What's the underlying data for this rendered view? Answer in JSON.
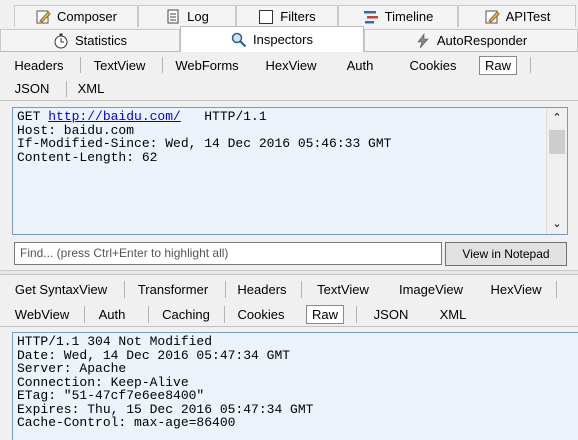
{
  "main_tabs_row1": [
    {
      "label": "Composer",
      "icon": "pencil-doc-icon"
    },
    {
      "label": "Log",
      "icon": "log-icon"
    },
    {
      "label": "Filters",
      "icon": "checkbox-icon"
    },
    {
      "label": "Timeline",
      "icon": "timeline-icon"
    },
    {
      "label": "APITest",
      "icon": "pencil-doc-icon"
    }
  ],
  "main_tabs_row2": [
    {
      "label": "Statistics",
      "icon": "stopwatch-icon"
    },
    {
      "label": "Inspectors",
      "icon": "magnifier-icon"
    },
    {
      "label": "AutoResponder",
      "icon": "lightning-icon"
    }
  ],
  "request": {
    "tabs_row1": [
      "Headers",
      "TextView",
      "WebForms",
      "HexView",
      "Auth",
      "Cookies",
      "Raw"
    ],
    "tabs_row2": [
      "JSON",
      "XML"
    ],
    "selected_tab": "Raw",
    "raw": {
      "method": "GET",
      "url": "http://baidu.com/",
      "protocol": "HTTP/1.1",
      "lines": [
        "Host: baidu.com",
        "If-Modified-Since: Wed, 14 Dec 2016 05:46:33 GMT",
        "Content-Length: 62"
      ]
    },
    "find_placeholder": "Find... (press Ctrl+Enter to highlight all)",
    "view_in_notepad": "View in Notepad"
  },
  "response": {
    "tabs_row1": [
      "Get SyntaxView",
      "Transformer",
      "Headers",
      "TextView",
      "ImageView",
      "HexView"
    ],
    "tabs_row2": [
      "WebView",
      "Auth",
      "Caching",
      "Cookies",
      "Raw",
      "JSON",
      "XML"
    ],
    "selected_tab": "Raw",
    "raw_lines": [
      "HTTP/1.1 304 Not Modified",
      "Date: Wed, 14 Dec 2016 05:47:34 GMT",
      "Server: Apache",
      "Connection: Keep-Alive",
      "ETag: \"51-47cf7e6ee8400\"",
      "Expires: Thu, 15 Dec 2016 05:47:34 GMT",
      "Cache-Control: max-age=86400"
    ]
  },
  "colors": {
    "textbox_bg": "#ecf3fb",
    "link": "#0000ee",
    "active_tab": "#ffffff"
  }
}
